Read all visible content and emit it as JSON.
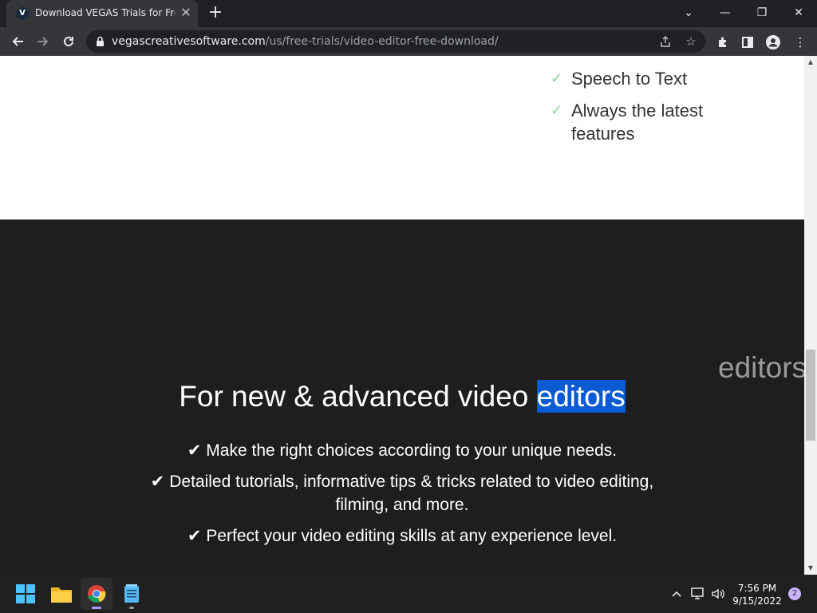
{
  "browser": {
    "tab": {
      "favicon_letter": "V",
      "title": "Download VEGAS Trials for Free |",
      "close_glyph": "✕"
    },
    "new_tab_glyph": "+",
    "window_controls": {
      "dropdown": "⌄",
      "minimize": "—",
      "restore": "❐",
      "close": "✕"
    },
    "address": {
      "host": "vegascreativesoftware.com",
      "path": "/us/free-trials/video-editor-free-download/"
    },
    "icons": [
      "back-icon",
      "forward-icon",
      "reload-icon",
      "lock-icon",
      "share-icon",
      "star-icon",
      "extensions-icon",
      "side-panel-icon",
      "profile-icon",
      "menu-icon"
    ]
  },
  "page": {
    "features": [
      {
        "check": "✓",
        "text": "Speech to Text"
      },
      {
        "check": "✓",
        "text": "Always the latest features"
      }
    ],
    "headline": {
      "prefix": "For new & advanced video ",
      "highlighted": "editors"
    },
    "side_ghost_text": "editors",
    "bullets": [
      "✔ Make the right choices according to your unique needs.",
      "✔ Detailed tutorials, informative tips & tricks related to video editing, filming, and more.",
      "✔ Perfect your video editing skills at any experience level."
    ]
  },
  "taskbar": {
    "apps": [
      "windows-start-icon",
      "file-explorer-icon",
      "chrome-icon",
      "notepad-icon"
    ],
    "time": "7:56 PM",
    "date": "9/15/2022",
    "notification_count": "2",
    "colors": {
      "accent": "#ad9bff",
      "selection": "#0a5bd3",
      "check_green": "#8bd49a"
    }
  }
}
